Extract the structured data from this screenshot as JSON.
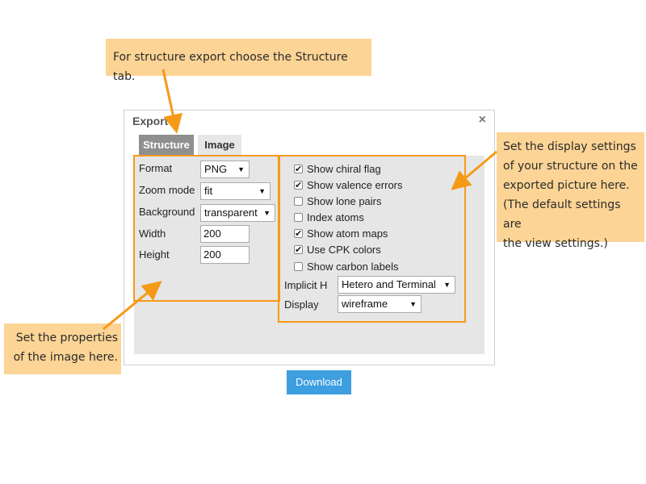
{
  "callouts": {
    "top": "For structure export choose the Structure tab.",
    "right_lines": [
      "Set the display settings",
      "of your structure on the",
      "exported picture here.",
      "(The default settings are",
      "the view settings.)"
    ],
    "left_lines": [
      "Set the properties",
      "of the image here."
    ]
  },
  "dialog": {
    "title": "Export",
    "close_icon": "×",
    "tabs": [
      {
        "label": "Structure",
        "active": true
      },
      {
        "label": "Image",
        "active": false
      }
    ],
    "image_props": {
      "format": {
        "label": "Format",
        "value": "PNG"
      },
      "zoom_mode": {
        "label": "Zoom mode",
        "value": "fit"
      },
      "background": {
        "label": "Background",
        "value": "transparent"
      },
      "width": {
        "label": "Width",
        "value": "200"
      },
      "height": {
        "label": "Height",
        "value": "200"
      }
    },
    "display": {
      "checkboxes": [
        {
          "label": "Show chiral flag",
          "checked": true
        },
        {
          "label": "Show valence errors",
          "checked": true
        },
        {
          "label": "Show lone pairs",
          "checked": false
        },
        {
          "label": "Index atoms",
          "checked": false
        },
        {
          "label": "Show atom maps",
          "checked": true
        },
        {
          "label": "Use CPK colors",
          "checked": true
        },
        {
          "label": "Show carbon labels",
          "checked": false
        }
      ],
      "implicit_h": {
        "label": "Implicit H",
        "value": "Hetero and Terminal"
      },
      "display_mode": {
        "label": "Display",
        "value": "wireframe"
      }
    },
    "download_label": "Download"
  },
  "colors": {
    "callout_bg": "#fcd495",
    "highlight": "#f59a17",
    "active_tab": "#8f8f8f",
    "download": "#3d9ee0"
  }
}
